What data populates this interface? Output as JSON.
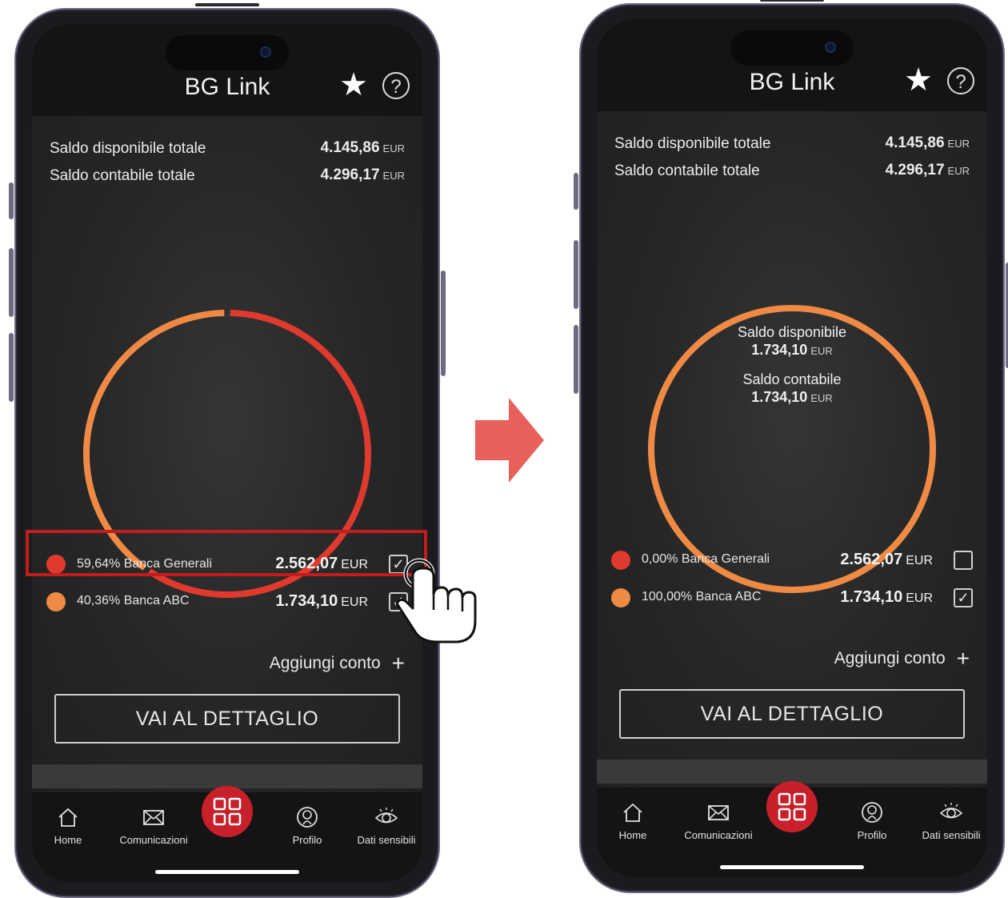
{
  "left_phone": {
    "app_title": "BG Link",
    "header": {
      "star_icon": "star-icon",
      "help_icon": "help-icon",
      "help_glyph": "?"
    },
    "summary": [
      {
        "label": "Saldo disponibile totale",
        "amount": "4.145,86",
        "currency": "EUR"
      },
      {
        "label": "Saldo contabile totale",
        "amount": "4.296,17",
        "currency": "EUR"
      }
    ],
    "accounts": [
      {
        "label": "59,64% Banca Generali",
        "amount": "2.562,07",
        "currency": "EUR",
        "checked": true,
        "color": "#e03a2e",
        "share": 59.64
      },
      {
        "label": "40,36% Banca ABC",
        "amount": "1.734,10",
        "currency": "EUR",
        "checked": true,
        "color": "#ef8a45",
        "share": 40.36
      }
    ],
    "add_account": "Aggiungi conto",
    "detail_button": "VAI AL DETTAGLIO",
    "tabs": [
      {
        "label": "Home",
        "icon": "home-icon"
      },
      {
        "label": "Comunicazioni",
        "icon": "mail-icon"
      },
      {
        "label": "Profilo",
        "icon": "profile-icon"
      },
      {
        "label": "Dati sensibili",
        "icon": "eye-icon"
      }
    ]
  },
  "right_phone": {
    "app_title": "BG Link",
    "header": {
      "star_icon": "star-icon",
      "help_icon": "help-icon",
      "help_glyph": "?"
    },
    "summary": [
      {
        "label": "Saldo disponibile totale",
        "amount": "4.145,86",
        "currency": "EUR"
      },
      {
        "label": "Saldo contabile totale",
        "amount": "4.296,17",
        "currency": "EUR"
      }
    ],
    "ring_center": {
      "available_label": "Saldo disponibile",
      "available_amount": "1.734,10",
      "accounting_label": "Saldo contabile",
      "accounting_amount": "1.734,10",
      "currency": "EUR"
    },
    "accounts": [
      {
        "label": "0,00% Banca Generali",
        "amount": "2.562,07",
        "currency": "EUR",
        "checked": false,
        "color": "#e03a2e",
        "share": 0
      },
      {
        "label": "100,00% Banca ABC",
        "amount": "1.734,10",
        "currency": "EUR",
        "checked": true,
        "color": "#ef8a45",
        "share": 100
      }
    ],
    "add_account": "Aggiungi conto",
    "detail_button": "VAI AL DETTAGLIO",
    "tabs": [
      {
        "label": "Home",
        "icon": "home-icon"
      },
      {
        "label": "Comunicazioni",
        "icon": "mail-icon"
      },
      {
        "label": "Profilo",
        "icon": "profile-icon"
      },
      {
        "label": "Dati sensibili",
        "icon": "eye-icon"
      }
    ]
  },
  "colors": {
    "accent_red": "#c8202a",
    "highlight": "#c11d1d",
    "arrow": "#e8605a",
    "ring_red": "#e03a2e",
    "ring_orange": "#ef8a45"
  },
  "checkmark_glyph": "✓"
}
